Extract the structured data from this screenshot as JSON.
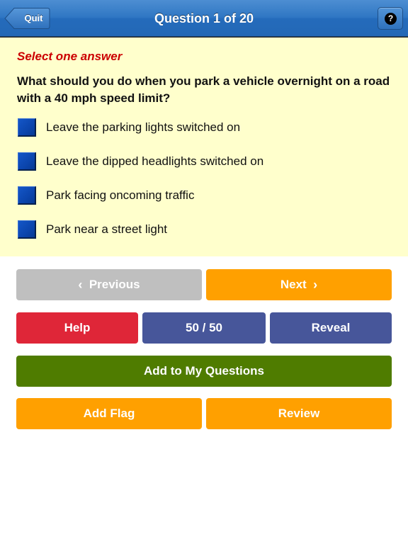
{
  "navbar": {
    "title": "Question 1 of 20",
    "back_button": "Quit",
    "help_icon": "question-mark-icon",
    "help_glyph": "?"
  },
  "question": {
    "instruction": "Select one answer",
    "text": "What should you do when you park a vehicle overnight on a road with a 40 mph speed limit?",
    "answers": [
      {
        "label": "Leave the parking lights switched on",
        "selected": false
      },
      {
        "label": "Leave the dipped headlights switched on",
        "selected": false
      },
      {
        "label": "Park facing oncoming traffic",
        "selected": false
      },
      {
        "label": "Park near a street light",
        "selected": false
      }
    ]
  },
  "buttons": {
    "previous": "Previous",
    "previous_icon": "‹",
    "next": "Next",
    "next_icon": "›",
    "help": "Help",
    "fifty_fifty": "50 / 50",
    "reveal": "Reveal",
    "add_to_my_questions": "Add to My Questions",
    "add_flag": "Add Flag",
    "review": "Review"
  },
  "colors": {
    "navbar": "#2f76c3",
    "panel_bg": "#ffffcc",
    "instruction": "#cc0000",
    "checkbox": "#0b45ad",
    "previous_disabled": "#bfbfbf",
    "orange": "#ffa000",
    "help_red": "#df2638",
    "indigo": "#47569a",
    "green": "#4f7c00"
  }
}
